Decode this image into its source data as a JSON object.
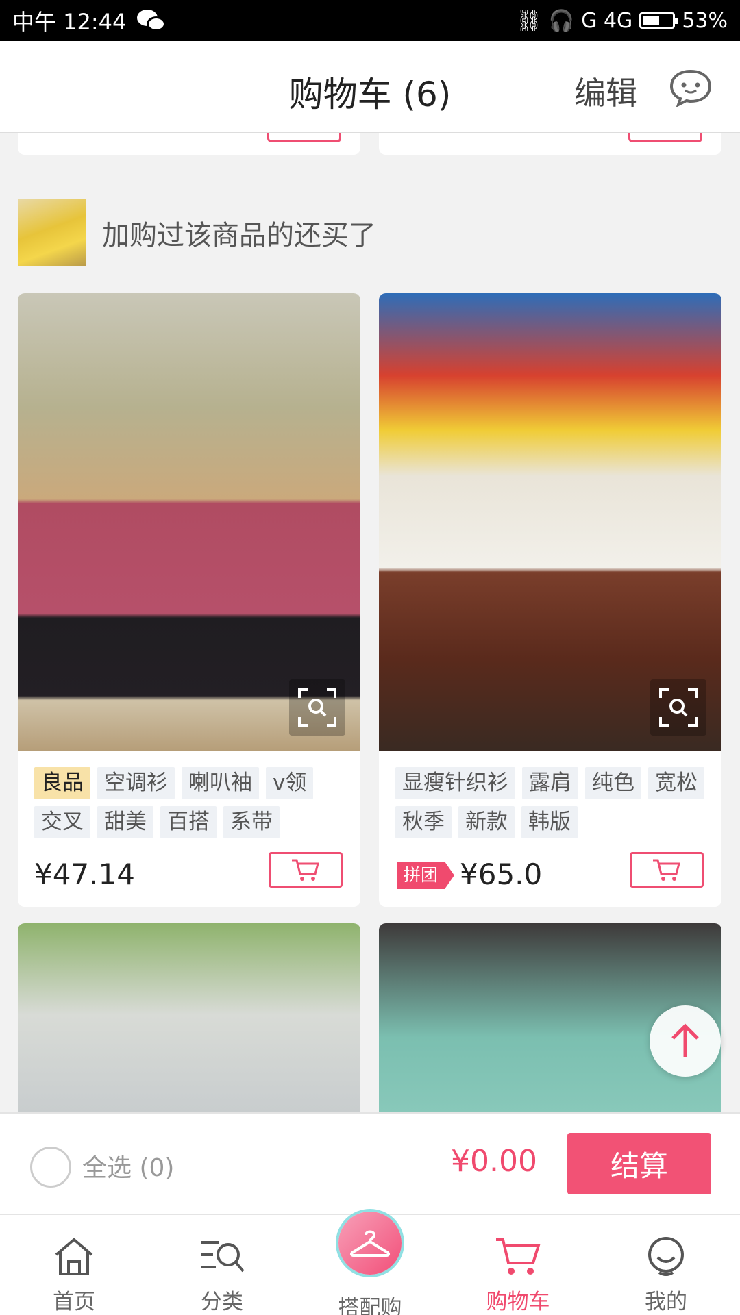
{
  "status_bar": {
    "time": "中午 12:44",
    "network": "G 4G",
    "battery": "53%"
  },
  "header": {
    "title": "购物车 (6)",
    "edit": "编辑"
  },
  "section": {
    "title": "加购过该商品的还买了"
  },
  "products": [
    {
      "tags": [
        "良品",
        "空调衫",
        "喇叭袖",
        "v领",
        "交叉",
        "甜美",
        "百搭",
        "系带"
      ],
      "price": "¥47.14",
      "pintuan": ""
    },
    {
      "tags": [
        "显瘦针织衫",
        "露肩",
        "纯色",
        "宽松",
        "秋季",
        "新款",
        "韩版"
      ],
      "price": "¥65.0",
      "pintuan": "拼团"
    }
  ],
  "checkout": {
    "select_all": "全选 (0)",
    "total": "¥0.00",
    "pay": "结算"
  },
  "tabbar": [
    {
      "label": "首页",
      "icon": "home-icon"
    },
    {
      "label": "分类",
      "icon": "category-search-icon"
    },
    {
      "label": "搭配购",
      "icon": "hanger-icon"
    },
    {
      "label": "购物车",
      "icon": "cart-icon"
    },
    {
      "label": "我的",
      "icon": "profile-icon"
    }
  ],
  "colors": {
    "accent": "#f04a6e",
    "gold_tag": "#f8e2a8",
    "tag_bg": "#eef1f5"
  }
}
